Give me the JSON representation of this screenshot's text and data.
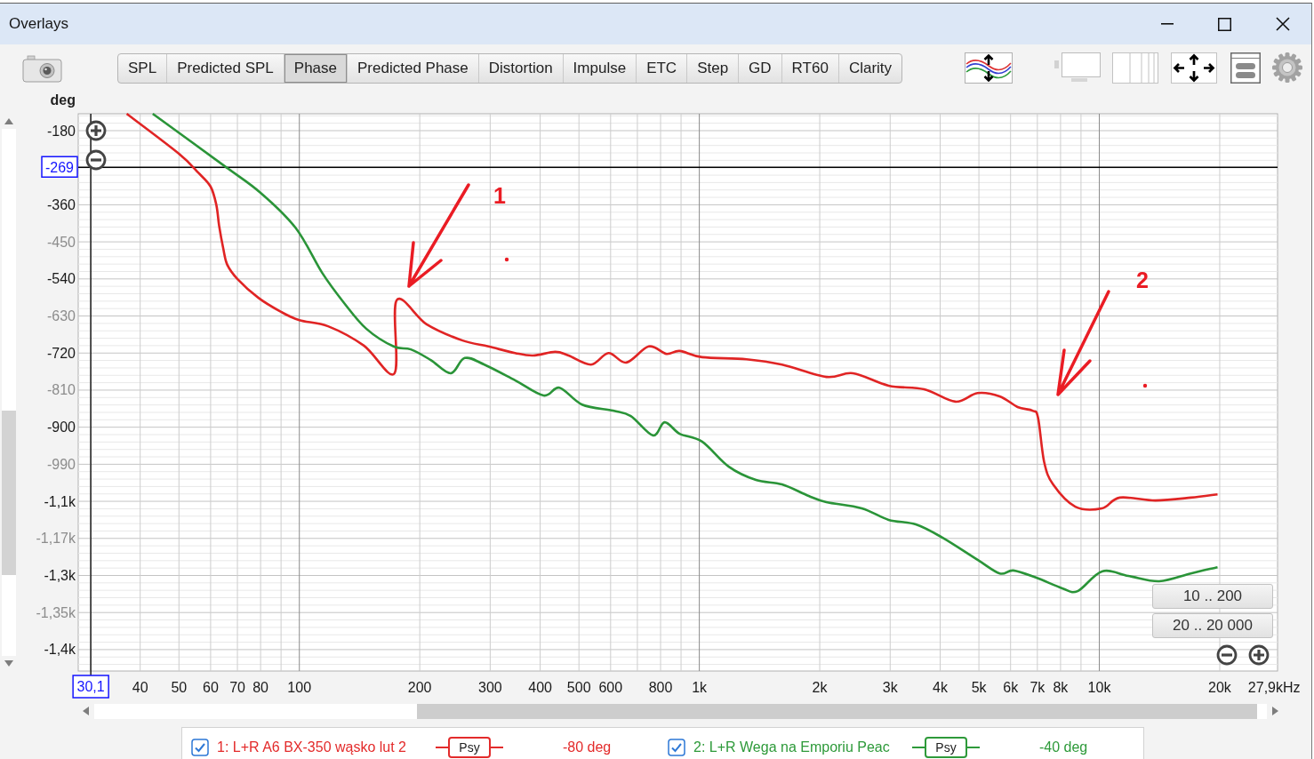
{
  "window": {
    "title": "Overlays"
  },
  "tabs": [
    {
      "label": "SPL",
      "selected": false
    },
    {
      "label": "Predicted SPL",
      "selected": false
    },
    {
      "label": "Phase",
      "selected": true
    },
    {
      "label": "Predicted Phase",
      "selected": false
    },
    {
      "label": "Distortion",
      "selected": false
    },
    {
      "label": "Impulse",
      "selected": false
    },
    {
      "label": "ETC",
      "selected": false
    },
    {
      "label": "Step",
      "selected": false
    },
    {
      "label": "GD",
      "selected": false
    },
    {
      "label": "RT60",
      "selected": false
    },
    {
      "label": "Clarity",
      "selected": false
    }
  ],
  "chart": {
    "chart_data": [
      {
        "type": "line",
        "ylabel": "deg",
        "xlabel": "Hz",
        "log": "x",
        "grid": true,
        "xlim": [
          28,
          27900
        ],
        "ylim": [
          -1492,
          -139
        ],
        "xticks": [
          {
            "value": 40,
            "label": "40"
          },
          {
            "value": 50,
            "label": "50"
          },
          {
            "value": 60,
            "label": "60"
          },
          {
            "value": 70,
            "label": "70"
          },
          {
            "value": 80,
            "label": "80"
          },
          {
            "value": 100,
            "label": "100"
          },
          {
            "value": 200,
            "label": "200"
          },
          {
            "value": 300,
            "label": "300"
          },
          {
            "value": 400,
            "label": "400"
          },
          {
            "value": 500,
            "label": "500"
          },
          {
            "value": 600,
            "label": "600"
          },
          {
            "value": 800,
            "label": "800"
          },
          {
            "value": 1000,
            "label": "1k"
          },
          {
            "value": 2000,
            "label": "2k"
          },
          {
            "value": 3000,
            "label": "3k"
          },
          {
            "value": 4000,
            "label": "4k"
          },
          {
            "value": 5000,
            "label": "5k"
          },
          {
            "value": 6000,
            "label": "6k"
          },
          {
            "value": 7000,
            "label": "7k"
          },
          {
            "value": 8000,
            "label": "8k"
          },
          {
            "value": 10000,
            "label": "10k"
          },
          {
            "value": 20000,
            "label": "20k"
          },
          {
            "value": 27900,
            "label": "27,9k"
          }
        ],
        "yticks": [
          {
            "value": -180,
            "label": "-180"
          },
          {
            "value": -360,
            "label": "-360"
          },
          {
            "value": -450,
            "label": "-450"
          },
          {
            "value": -540,
            "label": "-540"
          },
          {
            "value": -630,
            "label": "-630"
          },
          {
            "value": -720,
            "label": "-720"
          },
          {
            "value": -810,
            "label": "-810"
          },
          {
            "value": -900,
            "label": "-900"
          },
          {
            "value": -990,
            "label": "-990"
          },
          {
            "value": -1080,
            "label": "-1,1k"
          },
          {
            "value": -1170,
            "label": "-1,17k"
          },
          {
            "value": -1260,
            "label": "-1,3k"
          },
          {
            "value": -1350,
            "label": "-1,35k"
          },
          {
            "value": -1440,
            "label": "-1,4k"
          }
        ],
        "series": [
          {
            "color": "#e02424",
            "x": [
              37,
              50,
              56,
              60,
              62,
              63,
              64.5,
              66,
              70,
              79,
              90,
              100,
              118,
              145,
              173,
              175,
              208,
              255,
              297,
              346,
              384,
              436,
              471,
              536,
              593,
              657,
              747,
              828,
              893,
              1016,
              1312,
              1609,
              2078,
              2423,
              2973,
              3649,
              4365,
              4961,
              5637,
              6246,
              6813,
              7027,
              7282,
              7662,
              8710,
              10154,
              11250,
              13804,
              16943,
              19752
            ],
            "values": [
              -139,
              -236,
              -283,
              -316,
              -360,
              -410,
              -465,
              -505,
              -540,
              -586,
              -620,
              -640,
              -655,
              -702,
              -769,
              -592,
              -650,
              -689,
              -704,
              -720,
              -726,
              -717,
              -726,
              -748,
              -720,
              -743,
              -704,
              -722,
              -715,
              -730,
              -735,
              -748,
              -778,
              -769,
              -799,
              -808,
              -838,
              -817,
              -825,
              -851,
              -860,
              -877,
              -985,
              -1039,
              -1093,
              -1097,
              -1071,
              -1078,
              -1071,
              -1063
            ]
          },
          {
            "color": "#2a9438",
            "x": [
              43,
              65,
              80,
              98,
              114,
              129,
              147,
              172,
              190,
              213,
              239,
              259,
              290,
              346,
              408,
              447,
              509,
              609,
              674,
              766,
              819,
              893,
              1016,
              1185,
              1385,
              1609,
              1876,
              2078,
              2547,
              2973,
              3477,
              4051,
              4961,
              5637,
              6094,
              6939,
              8079,
              8828,
              10154,
              11822,
              14119,
              16943,
              19752
            ],
            "values": [
              -139,
              -266,
              -331,
              -417,
              -525,
              -597,
              -661,
              -704,
              -711,
              -737,
              -769,
              -732,
              -748,
              -786,
              -823,
              -804,
              -845,
              -860,
              -873,
              -920,
              -888,
              -916,
              -935,
              -996,
              -1028,
              -1039,
              -1067,
              -1082,
              -1097,
              -1125,
              -1136,
              -1168,
              -1222,
              -1255,
              -1248,
              -1265,
              -1291,
              -1298,
              -1250,
              -1261,
              -1274,
              -1255,
              -1240
            ]
          }
        ],
        "ref_lines": [
          {
            "axis": "x",
            "value": 30.1,
            "label": "30,1",
            "color": "#000000"
          },
          {
            "axis": "y",
            "value": -269,
            "label": "-269",
            "color": "#000000"
          }
        ],
        "annotations": [
          "1",
          "2"
        ]
      }
    ],
    "range_buttons": [
      "10 .. 200",
      "20 .. 20 000"
    ]
  },
  "legend": [
    {
      "checked": true,
      "label": "1: L+R A6 BX-350 wąsko lut 2",
      "color": "#e32b2b",
      "style": "Psy",
      "offset": "-80 deg"
    },
    {
      "checked": true,
      "label": "2: L+R Wega na Emporiu Peac",
      "color": "#2e9a3a",
      "style": "Psy",
      "offset": "-40 deg"
    }
  ]
}
